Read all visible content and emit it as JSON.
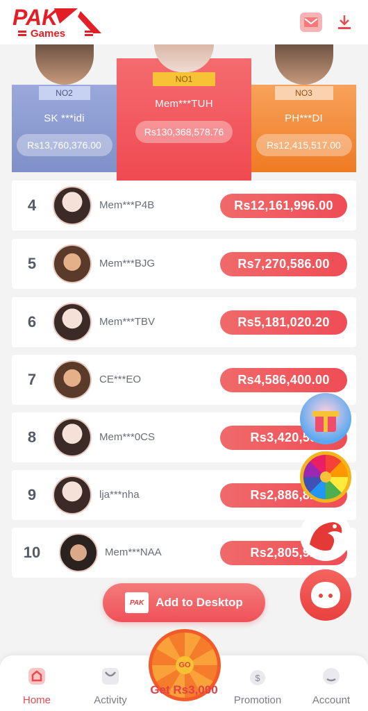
{
  "header": {
    "logo_text_top": "PAK",
    "logo_text_bottom": "Games",
    "mail_icon": "mail-icon",
    "download_icon": "download-icon"
  },
  "podium": [
    {
      "rank_label": "NO2",
      "name": "SK ***idi",
      "amount": "Rs13,760,376.00",
      "color": "#8f9fd3"
    },
    {
      "rank_label": "NO1",
      "name": "Mem***TUH",
      "amount": "Rs130,368,578.76",
      "color": "#f2565c"
    },
    {
      "rank_label": "NO3",
      "name": "PH***DI",
      "amount": "Rs12,415,517.00",
      "color": "#f3852e"
    }
  ],
  "ranking": [
    {
      "rank": "4",
      "name": "Mem***P4B",
      "amount": "Rs12,161,996.00"
    },
    {
      "rank": "5",
      "name": "Mem***BJG",
      "amount": "Rs7,270,586.00"
    },
    {
      "rank": "6",
      "name": "Mem***TBV",
      "amount": "Rs5,181,020.20"
    },
    {
      "rank": "7",
      "name": "CE***EO",
      "amount": "Rs4,586,400.00"
    },
    {
      "rank": "8",
      "name": "Mem***0CS",
      "amount": "Rs3,420,59"
    },
    {
      "rank": "9",
      "name": "lja***nha",
      "amount": "Rs2,886,82"
    },
    {
      "rank": "10",
      "name": "Mem***NAA",
      "amount": "Rs2,805,92"
    }
  ],
  "add_to_desktop": {
    "label": "Add to Desktop",
    "mini_logo": "PAK"
  },
  "wheel": {
    "center_label": "GO",
    "label": "Get Rs3,000"
  },
  "tabs": [
    {
      "label": "Home",
      "icon": "home-icon"
    },
    {
      "label": "Activity",
      "icon": "activity-icon"
    },
    {
      "label": "Promotion",
      "icon": "promotion-icon"
    },
    {
      "label": "Account",
      "icon": "account-icon"
    }
  ],
  "colors": {
    "accent": "#ef4d55",
    "no2": "#8f9fd3",
    "no1": "#f2565c",
    "no3": "#f3852e"
  }
}
